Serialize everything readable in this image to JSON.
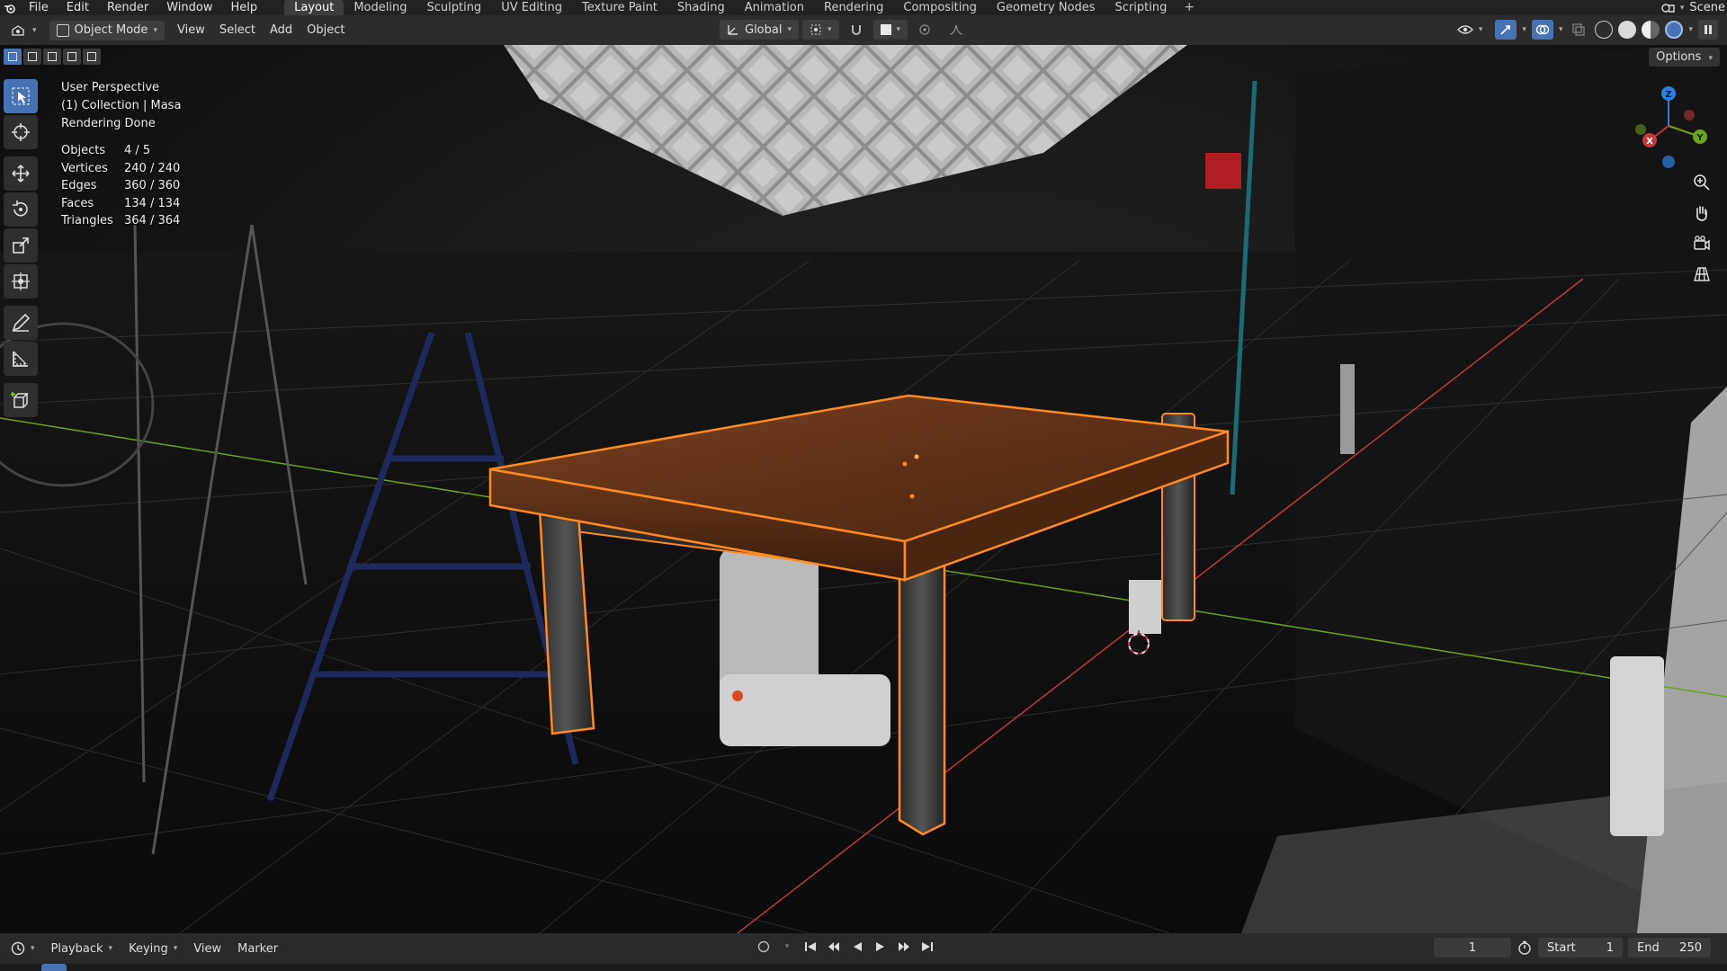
{
  "topbar": {
    "menus": [
      "File",
      "Edit",
      "Render",
      "Window",
      "Help"
    ],
    "workspaces": [
      "Layout",
      "Modeling",
      "Sculpting",
      "UV Editing",
      "Texture Paint",
      "Shading",
      "Animation",
      "Rendering",
      "Compositing",
      "Geometry Nodes",
      "Scripting"
    ],
    "active_workspace": "Layout",
    "add_workspace": "+",
    "scene_label": "Scene"
  },
  "header": {
    "mode": "Object Mode",
    "menus": [
      "View",
      "Select",
      "Add",
      "Object"
    ],
    "transform_orientation": "Global"
  },
  "overlay": {
    "view_name": "User Perspective",
    "collection_object": "(1) Collection | Masa",
    "render_status": "Rendering Done",
    "stats": [
      {
        "label": "Objects",
        "value": "4 / 5"
      },
      {
        "label": "Vertices",
        "value": "240 / 240"
      },
      {
        "label": "Edges",
        "value": "360 / 360"
      },
      {
        "label": "Faces",
        "value": "134 / 134"
      },
      {
        "label": "Triangles",
        "value": "364 / 364"
      }
    ]
  },
  "viewport": {
    "options_label": "Options",
    "gizmo": {
      "x": "X",
      "y": "Y",
      "z": "Z"
    },
    "colors": {
      "selection_outline": "#ff8a1f",
      "x_axis": "#c2393e",
      "y_axis": "#6ea11e",
      "z_axis": "#2f7fe0",
      "active_tool": "#4772b3",
      "table_top": "#6b3a1d"
    }
  },
  "timeline": {
    "menus": [
      "Playback",
      "Keying",
      "View",
      "Marker"
    ],
    "current_frame": "1",
    "start_label": "Start",
    "start_value": "1",
    "end_label": "End",
    "end_value": "250"
  }
}
